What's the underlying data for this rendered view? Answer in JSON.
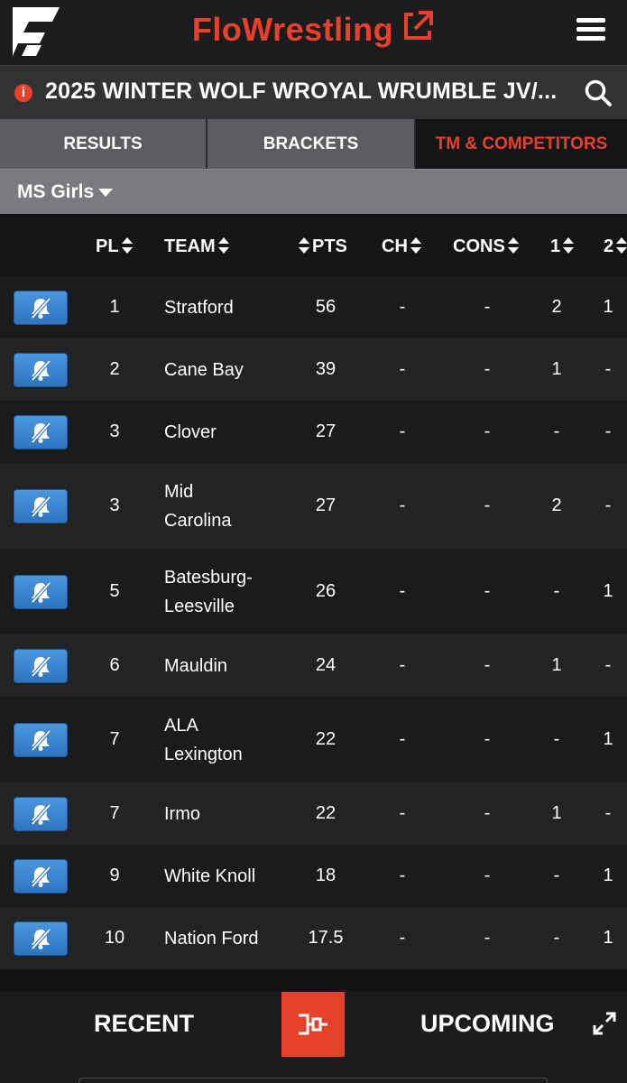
{
  "header": {
    "brand": "FloWrestling",
    "brand_color": "#e8412b",
    "logo_icon": "flo-logo-icon",
    "external_link_icon": "external-link-icon",
    "menu_icon": "hamburger-menu-icon"
  },
  "event": {
    "title": "2025 WINTER WOLF WROYAL WRUMBLE JV/...",
    "info_icon": "info-icon",
    "search_icon": "search-icon"
  },
  "tabs": [
    {
      "label": "RESULTS",
      "active": false
    },
    {
      "label": "BRACKETS",
      "active": false
    },
    {
      "label": "TM & COMPETITORS",
      "active": true
    }
  ],
  "division": {
    "selected": "MS Girls"
  },
  "table": {
    "columns": {
      "pl": "PL",
      "team": "TEAM",
      "pts": "PTS",
      "ch": "CH",
      "cons": "CONS",
      "c1": "1",
      "c2": "2"
    },
    "rows": [
      {
        "pl": "1",
        "team": [
          "Stratford"
        ],
        "pts": "56",
        "ch": "-",
        "cons": "-",
        "c1": "2",
        "c2": "1"
      },
      {
        "pl": "2",
        "team": [
          "Cane Bay"
        ],
        "pts": "39",
        "ch": "-",
        "cons": "-",
        "c1": "1",
        "c2": "-"
      },
      {
        "pl": "3",
        "team": [
          "Clover"
        ],
        "pts": "27",
        "ch": "-",
        "cons": "-",
        "c1": "-",
        "c2": "-"
      },
      {
        "pl": "3",
        "team": [
          "Mid",
          "Carolina"
        ],
        "pts": "27",
        "ch": "-",
        "cons": "-",
        "c1": "2",
        "c2": "-"
      },
      {
        "pl": "5",
        "team": [
          "Batesburg-",
          "Leesville"
        ],
        "pts": "26",
        "ch": "-",
        "cons": "-",
        "c1": "-",
        "c2": "1"
      },
      {
        "pl": "6",
        "team": [
          "Mauldin"
        ],
        "pts": "24",
        "ch": "-",
        "cons": "-",
        "c1": "1",
        "c2": "-"
      },
      {
        "pl": "7",
        "team": [
          "ALA",
          "Lexington"
        ],
        "pts": "22",
        "ch": "-",
        "cons": "-",
        "c1": "-",
        "c2": "1"
      },
      {
        "pl": "7",
        "team": [
          "Irmo"
        ],
        "pts": "22",
        "ch": "-",
        "cons": "-",
        "c1": "1",
        "c2": "-"
      },
      {
        "pl": "9",
        "team": [
          "White Knoll"
        ],
        "pts": "18",
        "ch": "-",
        "cons": "-",
        "c1": "-",
        "c2": "1"
      },
      {
        "pl": "10",
        "team": [
          "Nation Ford"
        ],
        "pts": "17.5",
        "ch": "-",
        "cons": "-",
        "c1": "-",
        "c2": "1"
      }
    ],
    "row_button_icon": "bell-off-icon"
  },
  "bottom": {
    "recent": "RECENT",
    "upcoming": "UPCOMING",
    "bracket_icon": "bracket-icon",
    "expand_icon": "expand-icon"
  }
}
